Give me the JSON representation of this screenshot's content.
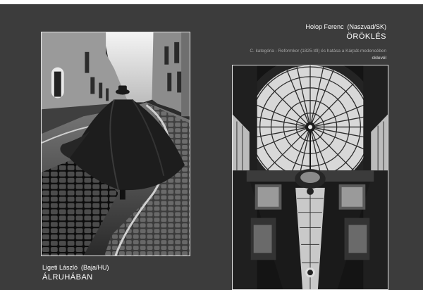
{
  "entries": [
    {
      "author": "Ligeti László  (Baja/HU)",
      "title": "ÁLRUHÁBAN",
      "photo_icon": "street-cloak-photo"
    },
    {
      "author": "Holop Ferenc  (Naszvad/SK)",
      "title": "ÖRÖKLÉS",
      "category": "C. kategória - Reformkor (1825-től) és hatása a Kárpát-medencében",
      "award": "oklevél",
      "photo_icon": "arcade-dome-photo"
    }
  ],
  "colors": {
    "background": "#3c3c3c",
    "frame": "#e8e8e8",
    "text": "#ffffff",
    "category_text": "#a6a6a6"
  }
}
